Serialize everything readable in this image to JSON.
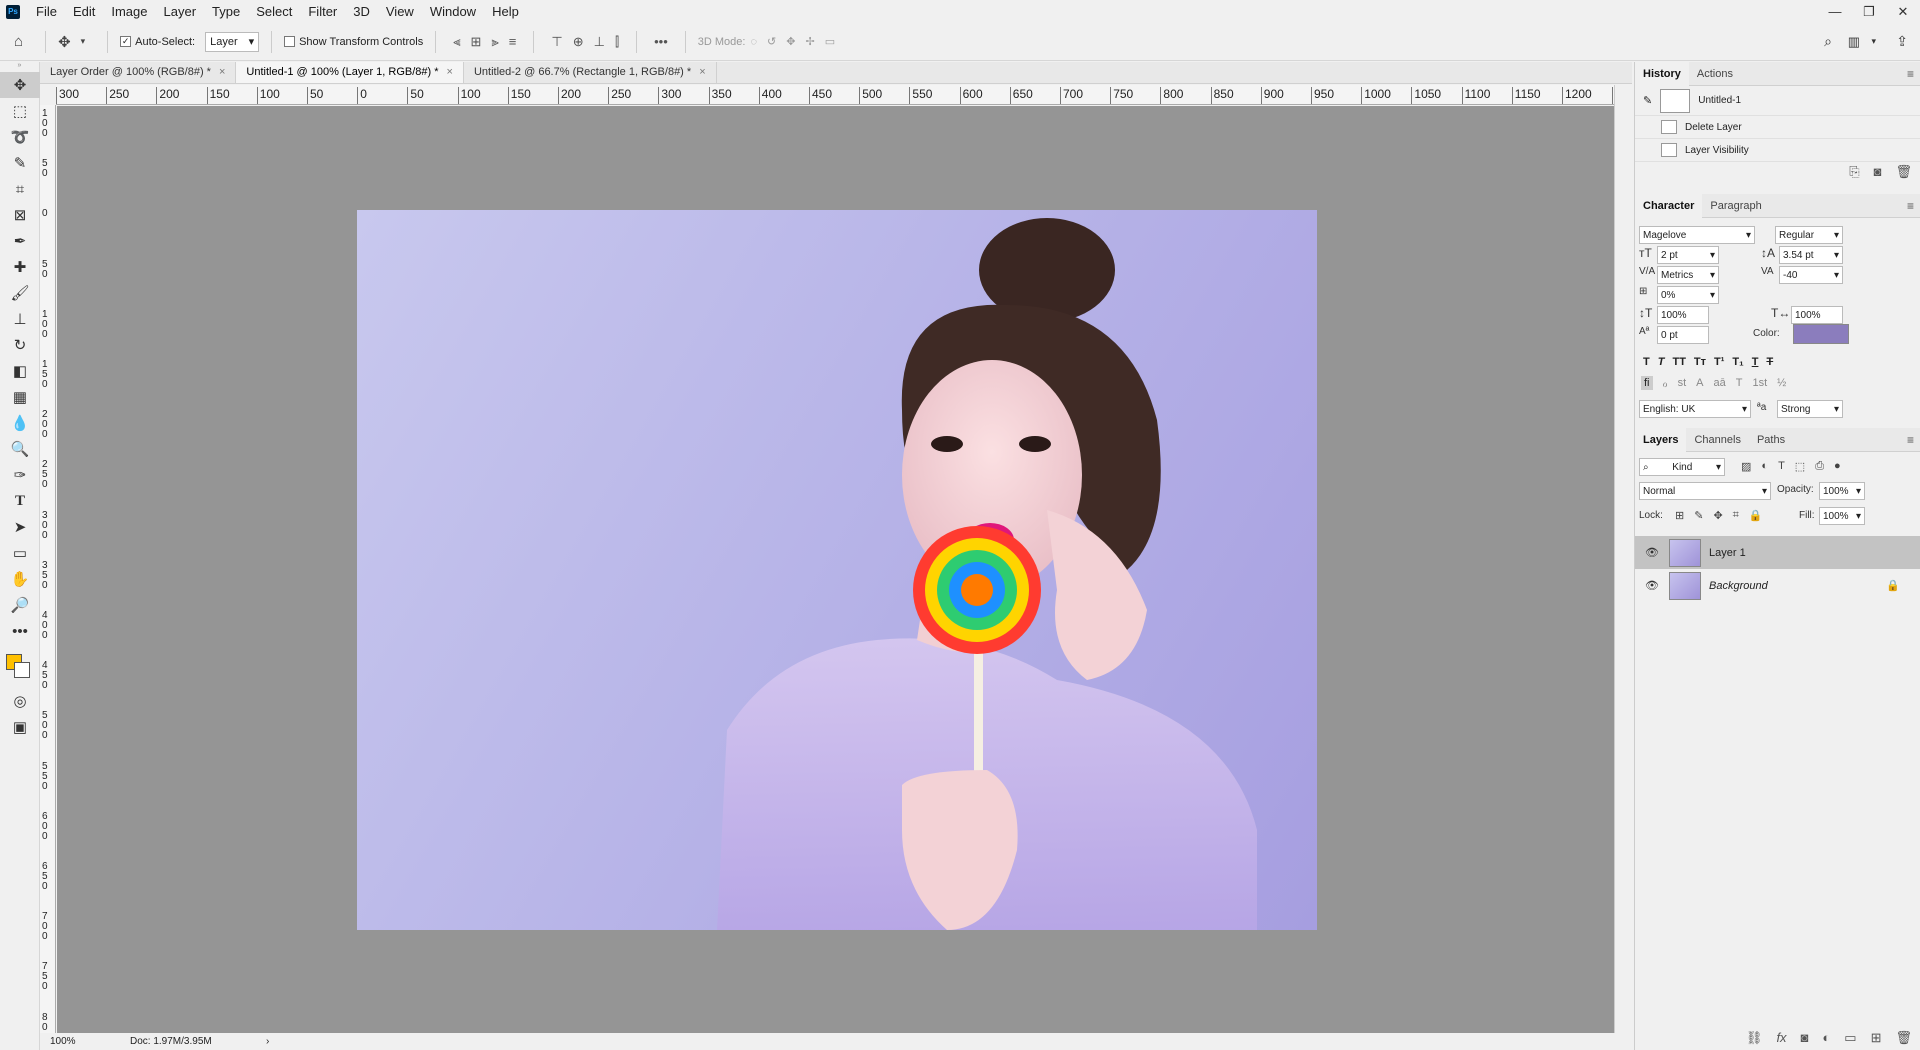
{
  "app": {
    "logo": "Ps"
  },
  "menu": [
    "File",
    "Edit",
    "Image",
    "Layer",
    "Type",
    "Select",
    "Filter",
    "3D",
    "View",
    "Window",
    "Help"
  ],
  "window_controls": {
    "minimize": "—",
    "restore": "❐",
    "close": "✕"
  },
  "options": {
    "auto_select_label": "Auto-Select:",
    "auto_select_value": "Layer",
    "show_transform_label": "Show Transform Controls",
    "more": "•••",
    "mode_3d": "3D Mode:"
  },
  "tabs": [
    {
      "label": "Layer Order @ 100% (RGB/8#) *",
      "close": "×"
    },
    {
      "label": "Untitled-1 @ 100% (Layer 1, RGB/8#) *",
      "close": "×"
    },
    {
      "label": "Untitled-2 @ 66.7% (Rectangle 1, RGB/8#) *",
      "close": "×"
    }
  ],
  "hruler": [
    "300",
    "250",
    "200",
    "150",
    "100",
    "50",
    "0",
    "50",
    "100",
    "150",
    "200",
    "250",
    "300",
    "350",
    "400",
    "450",
    "500",
    "550",
    "600",
    "650",
    "700",
    "750",
    "800",
    "850",
    "900",
    "950",
    "1000",
    "1050",
    "1100",
    "1150",
    "1200",
    "1"
  ],
  "vruler": [
    "100",
    "50",
    "0",
    "50",
    "100",
    "150",
    "200",
    "250",
    "300",
    "350",
    "400",
    "450",
    "500",
    "550",
    "600",
    "650",
    "700",
    "750",
    "800",
    "850"
  ],
  "status": {
    "zoom": "100%",
    "doc": "Doc: 1.97M/3.95M",
    "arrow": "›"
  },
  "history": {
    "tabs": [
      "History",
      "Actions"
    ],
    "snapshot": "Untitled-1",
    "items": [
      "Delete Layer",
      "Layer Visibility"
    ]
  },
  "character": {
    "tabs": [
      "Character",
      "Paragraph"
    ],
    "font_family": "Magelove",
    "font_style": "Regular",
    "size": "2 pt",
    "leading": "3.54 pt",
    "kerning": "Metrics",
    "tracking": "-40",
    "tsume": "0%",
    "vscale": "100%",
    "hscale": "100%",
    "baseline": "0 pt",
    "color_label": "Color:",
    "color": "#8b7dbd",
    "style_buttons": [
      "T",
      "T",
      "TT",
      "Tт",
      "T¹",
      "T₁",
      "T",
      "T"
    ],
    "ot_buttons": [
      "fi",
      "ℴ",
      "st",
      "A",
      "aā",
      "T",
      "1st",
      "½"
    ],
    "language": "English: UK",
    "aa_icon": "ªa",
    "antialias": "Strong"
  },
  "layers": {
    "tabs": [
      "Layers",
      "Channels",
      "Paths"
    ],
    "filter_kind": "Kind",
    "blend_mode": "Normal",
    "opacity_label": "Opacity:",
    "opacity": "100%",
    "lock_label": "Lock:",
    "fill_label": "Fill:",
    "fill": "100%",
    "items": [
      {
        "name": "Layer 1",
        "visible": true
      },
      {
        "name": "Background",
        "visible": true,
        "locked": true
      }
    ]
  }
}
